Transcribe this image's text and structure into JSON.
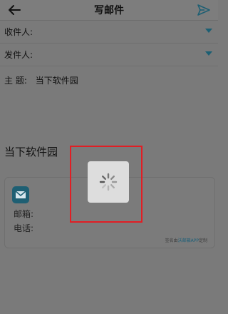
{
  "header": {
    "title": "写邮件",
    "back_icon": "arrow-left-icon",
    "send_icon": "paper-plane-icon",
    "send_color": "#1e5f73"
  },
  "form": {
    "recipient_label": "收件人:",
    "sender_label": "发件人:",
    "subject_label": "主   题:",
    "subject_value": "当下软件园"
  },
  "signature": {
    "title": "当下软件园",
    "email_label": "邮箱:",
    "phone_label": "电话:",
    "footer_prefix": "签名由",
    "footer_link": "沃邮箱APP",
    "footer_suffix": "定制"
  },
  "overlay": {
    "loading_icon": "loading-spinner-icon",
    "highlight_color": "#e11e24"
  }
}
